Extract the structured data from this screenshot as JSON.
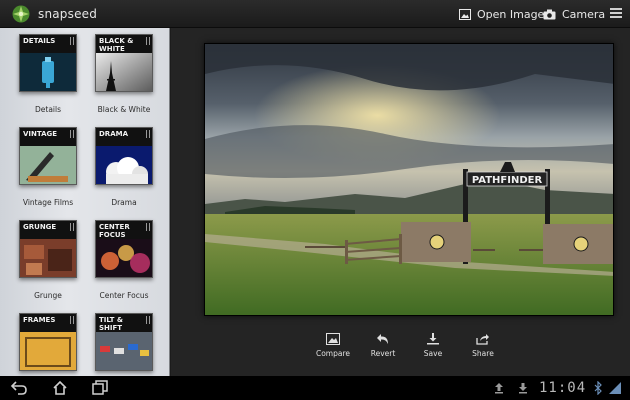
{
  "app": {
    "name": "snapseed"
  },
  "topbar": {
    "open_image_label": "Open Image",
    "camera_label": "Camera"
  },
  "filters": [
    {
      "thumb_title": "DETAILS",
      "label": "Details"
    },
    {
      "thumb_title": "BLACK & WHITE",
      "label": "Black & White"
    },
    {
      "thumb_title": "VINTAGE",
      "label": "Vintage Films"
    },
    {
      "thumb_title": "DRAMA",
      "label": "Drama"
    },
    {
      "thumb_title": "GRUNGE",
      "label": "Grunge"
    },
    {
      "thumb_title": "CENTER FOCUS",
      "label": "Center Focus"
    },
    {
      "thumb_title": "FRAMES",
      "label": ""
    },
    {
      "thumb_title": "TILT & SHIFT",
      "label": ""
    }
  ],
  "photo": {
    "sign_text": "PATHFINDER"
  },
  "actions": {
    "compare": "Compare",
    "revert": "Revert",
    "save": "Save",
    "share": "Share"
  },
  "status": {
    "time": "11:04"
  },
  "colors": {
    "accent_green": "#6fae3a",
    "topbar": "#222222",
    "sidebar": "#dcdfe3"
  }
}
